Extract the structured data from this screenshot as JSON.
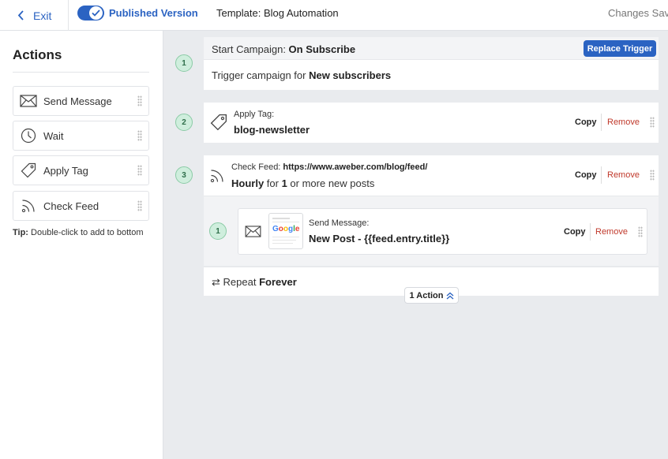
{
  "topbar": {
    "exit_label": "Exit",
    "published_label": "Published Version",
    "template_title": "Template: Blog Automation",
    "status_text": "Changes Sav"
  },
  "sidebar": {
    "title": "Actions",
    "items": [
      {
        "label": "Send Message",
        "icon": "envelope-icon"
      },
      {
        "label": "Wait",
        "icon": "clock-icon"
      },
      {
        "label": "Apply Tag",
        "icon": "tag-icon"
      },
      {
        "label": "Check Feed",
        "icon": "rss-icon"
      }
    ],
    "tip_bold": "Tip:",
    "tip_text": " Double-click to add to bottom"
  },
  "steps": {
    "trigger": {
      "number": "1",
      "head_prefix": "Start Campaign: ",
      "head_value": "On Subscribe",
      "replace_label": "Replace Trigger",
      "body_prefix": "Trigger campaign for ",
      "body_value": "New subscribers"
    },
    "tag": {
      "number": "2",
      "head": "Apply Tag:",
      "value": "blog-newsletter",
      "copy": "Copy",
      "remove": "Remove"
    },
    "feed": {
      "number": "3",
      "head_prefix": "Check Feed: ",
      "url": "https://www.aweber.com/blog/feed/",
      "freq": "Hourly",
      "mid": " for ",
      "count": "1",
      "suffix": " or more new posts",
      "copy": "Copy",
      "remove": "Remove"
    },
    "message": {
      "number": "1",
      "head": "Send Message:",
      "value": "New Post - {{feed.entry.title}}",
      "copy": "Copy",
      "remove": "Remove",
      "thumb_logo": "Google"
    },
    "repeat": {
      "prefix": " Repeat ",
      "value": "Forever",
      "pill": "1 Action"
    }
  },
  "colors": {
    "accent": "#2b63c2",
    "remove": "#c0392b",
    "step_badge": "#cfeedd"
  }
}
